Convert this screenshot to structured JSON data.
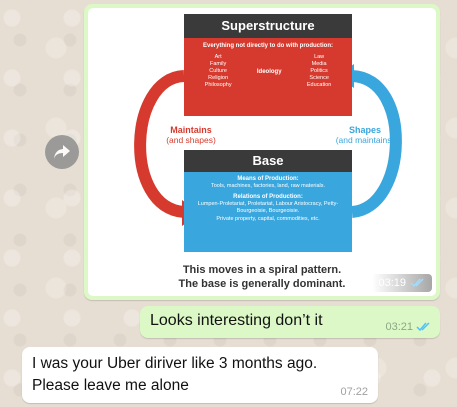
{
  "messages": {
    "image_message": {
      "time": "03:19",
      "diagram": {
        "superstructure": {
          "title": "Superstructure",
          "subtitle": "Everything not directly to do with production:",
          "left_items": [
            "Art",
            "Family",
            "Culture",
            "Religion",
            "Philosophy"
          ],
          "middle": "Ideology",
          "right_items": [
            "Law",
            "Media",
            "Politics",
            "Science",
            "Education"
          ]
        },
        "base": {
          "title": "Base",
          "means_title": "Means of Production:",
          "means_text": "Tools, machines, factories, land, raw materials.",
          "relations_title": "Relations of Production:",
          "relations_text": "Lumpen-Proletariat, Proletariat, Labour Aristocracy, Petty-Bourgeoisie, Bourgeoisie.",
          "property_text": "Private property, capital, commodities, etc."
        },
        "left_label": {
          "main": "Maintains",
          "sub": "(and shapes)"
        },
        "right_label": {
          "main": "Shapes",
          "sub": "(and maintains)"
        },
        "caption_line1": "This moves in a spiral pattern.",
        "caption_line2": "The base is generally dominant."
      }
    },
    "outgoing": {
      "text": "Looks interesting don’t it",
      "time": "03:21"
    },
    "incoming": {
      "text_line1": "I was your Uber diriver like 3 months ago.",
      "text_line2": "Please leave me alone",
      "time": "07:22"
    }
  },
  "icons": {
    "forward": "forward-icon",
    "read_receipt": "double-check-icon"
  },
  "colors": {
    "outgoing_bubble": "#dcf8c6",
    "incoming_bubble": "#ffffff",
    "read_tick": "#4fc3f7",
    "superstructure_red": "#d63a2e",
    "base_blue": "#3aa6de"
  }
}
